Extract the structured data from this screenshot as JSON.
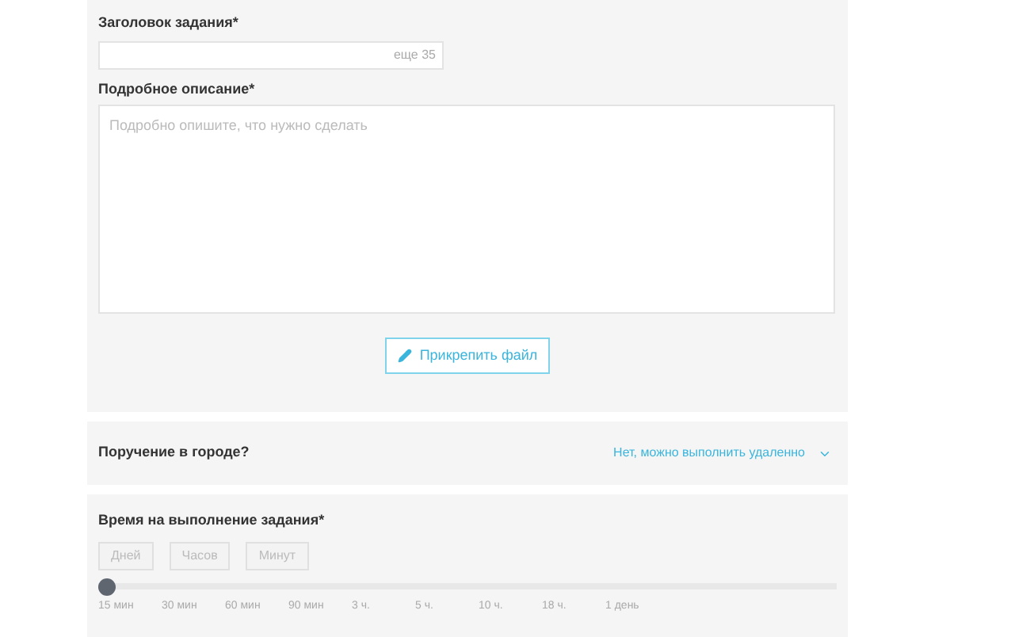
{
  "title_field": {
    "label": "Заголовок задания*",
    "counter": "еще 35"
  },
  "description_field": {
    "label": "Подробное описание*",
    "placeholder": "Подробно опишите, что нужно сделать"
  },
  "attach_button": {
    "label": "Прикрепить файл"
  },
  "city_task": {
    "question": "Поручение в городе?",
    "value": "Нет, можно выполнить удаленно"
  },
  "duration": {
    "label": "Время на выполнение задания*",
    "units": [
      {
        "label": "Дней",
        "selected": false
      },
      {
        "label": "Часов",
        "selected": false
      },
      {
        "label": "Минут",
        "selected": false
      }
    ],
    "slider": {
      "level": 0,
      "ticks": [
        "15 мин",
        "30 мин",
        "60 мин",
        "90 мин",
        "3 ч.",
        "5 ч.",
        "10 ч.",
        "18 ч.",
        "1 день"
      ]
    }
  }
}
